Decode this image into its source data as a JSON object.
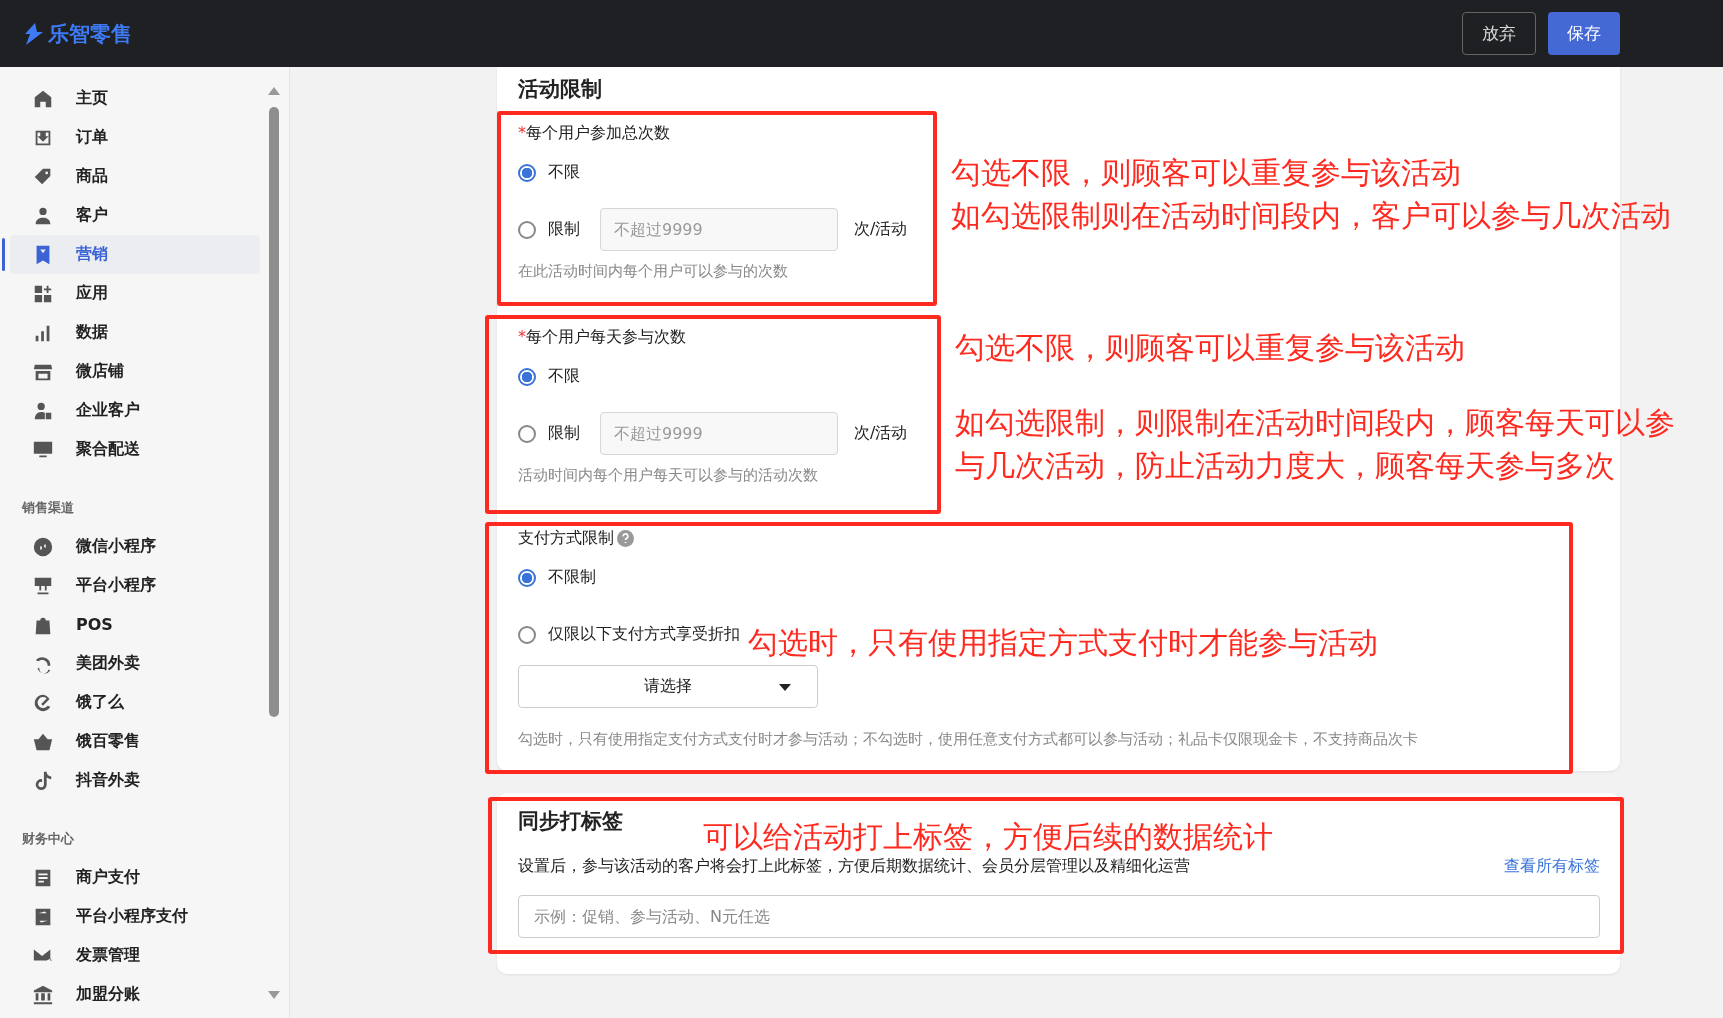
{
  "app": {
    "logo": "乐智零售"
  },
  "header_buttons": [
    {
      "label": "放弃",
      "kind": "secondary"
    },
    {
      "label": "保存",
      "kind": "primary"
    }
  ],
  "sidebar": {
    "groups": [
      {
        "items": [
          {
            "label": "主页",
            "selected": false
          },
          {
            "label": "订单",
            "selected": false
          },
          {
            "label": "商品",
            "selected": false
          },
          {
            "label": "客户",
            "selected": false
          },
          {
            "label": "营销",
            "selected": true
          },
          {
            "label": "应用",
            "selected": false
          },
          {
            "label": "数据",
            "selected": false
          },
          {
            "label": "微店铺",
            "selected": false
          },
          {
            "label": "企业客户",
            "selected": false
          },
          {
            "label": "聚合配送",
            "selected": false
          }
        ]
      },
      {
        "title": "销售渠道",
        "items": [
          {
            "label": "微信小程序",
            "selected": false
          },
          {
            "label": "平台小程序",
            "selected": false
          },
          {
            "label": "POS",
            "selected": false
          },
          {
            "label": "美团外卖",
            "selected": false
          },
          {
            "label": "饿了么",
            "selected": false
          },
          {
            "label": "饿百零售",
            "selected": false
          },
          {
            "label": "抖音外卖",
            "selected": false
          }
        ]
      },
      {
        "title": "财务中心",
        "items": [
          {
            "label": "商户支付",
            "selected": false
          },
          {
            "label": "平台小程序支付",
            "selected": false
          },
          {
            "label": "发票管理",
            "selected": false
          },
          {
            "label": "加盟分账",
            "selected": false
          }
        ]
      }
    ]
  },
  "activity_limits": {
    "title": "活动限制",
    "fields": [
      {
        "label": "每个用户参加总次数",
        "required_mark": "*",
        "options": [
          {
            "label": "不限",
            "selected": true
          },
          {
            "label": "限制",
            "selected": false
          }
        ],
        "input": {
          "placeholder": "不超过9999"
        },
        "unit": "次/活动",
        "help": "在此活动时间内每个用户可以参与的次数",
        "annotations": [
          "勾选不限，则顾客可以重复参与该活动",
          "如勾选限制则在活动时间段内，客户可以参与几次活动"
        ]
      },
      {
        "label": "每个用户每天参与次数",
        "required_mark": "*",
        "options": [
          {
            "label": "不限",
            "selected": true
          },
          {
            "label": "限制",
            "selected": false
          }
        ],
        "input": {
          "placeholder": "不超过9999"
        },
        "unit": "次/活动",
        "help": "活动时间内每个用户每天可以参与的活动次数",
        "annotations": [
          "勾选不限，则顾客可以重复参与该活动",
          "如勾选限制，则限制在活动时间段内，顾客每天可以参与几次活动，防止活动力度大，顾客每天参与多次"
        ]
      }
    ],
    "payment": {
      "label": "支付方式限制",
      "options": [
        {
          "label": "不限制",
          "selected": true
        },
        {
          "label": "仅限以下支付方式享受折扣",
          "selected": false
        }
      ],
      "annotation": "勾选时，只有使用指定方式支付时才能参与活动",
      "select": {
        "placeholder": "请选择"
      },
      "help": "勾选时，只有使用指定支付方式支付时才参与活动；不勾选时，使用任意支付方式都可以参与活动；礼品卡仅限现金卡，不支持商品次卡"
    }
  },
  "tagging": {
    "title": "同步打标签",
    "annotation": "可以给活动打上标签，方便后续的数据统计",
    "description": "设置后，参与该活动的客户将会打上此标签，方便后期数据统计、会员分层管理以及精细化运营",
    "link": "查看所有标签",
    "input": {
      "placeholder": "示例：促销、参与活动、N元任选"
    }
  }
}
